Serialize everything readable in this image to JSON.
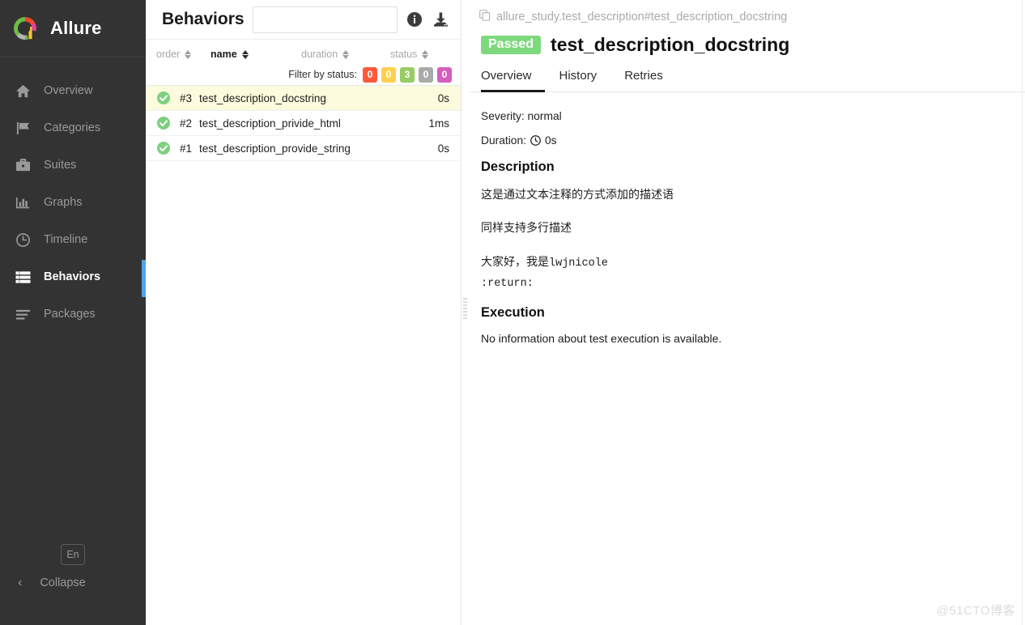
{
  "sidebar": {
    "brand": "Allure",
    "items": [
      {
        "label": "Overview",
        "icon": "home-icon",
        "active": false
      },
      {
        "label": "Categories",
        "icon": "flag-icon",
        "active": false
      },
      {
        "label": "Suites",
        "icon": "briefcase-icon",
        "active": false
      },
      {
        "label": "Graphs",
        "icon": "bar-chart-icon",
        "active": false
      },
      {
        "label": "Timeline",
        "icon": "clock-icon",
        "active": false
      },
      {
        "label": "Behaviors",
        "icon": "list-icon",
        "active": true
      },
      {
        "label": "Packages",
        "icon": "layers-icon",
        "active": false
      }
    ],
    "language_button": "En",
    "collapse_label": "Collapse",
    "active_indicator_color": "#4da3f0"
  },
  "list_pane": {
    "title": "Behaviors",
    "search": {
      "value": "",
      "placeholder": ""
    },
    "info_icon": "info-icon",
    "download_icon": "download-icon",
    "columns": [
      {
        "key": "order",
        "label": "order",
        "active": false
      },
      {
        "key": "name",
        "label": "name",
        "active": true
      },
      {
        "key": "duration",
        "label": "duration",
        "active": false
      },
      {
        "key": "status",
        "label": "status",
        "active": false
      }
    ],
    "filter": {
      "label": "Filter by status:",
      "badges": [
        {
          "status": "failed",
          "count": "0",
          "color": "#fd5a3e"
        },
        {
          "status": "broken",
          "count": "0",
          "color": "#ffd050"
        },
        {
          "status": "passed",
          "count": "3",
          "color": "#97cc64"
        },
        {
          "status": "skipped",
          "count": "0",
          "color": "#aaaaaa"
        },
        {
          "status": "unknown",
          "count": "0",
          "color": "#d35ebe"
        }
      ]
    },
    "rows": [
      {
        "order": "#3",
        "name": "test_description_docstring",
        "duration": "0s",
        "status": "passed",
        "selected": true
      },
      {
        "order": "#2",
        "name": "test_description_privide_html",
        "duration": "1ms",
        "status": "passed",
        "selected": false
      },
      {
        "order": "#1",
        "name": "test_description_provide_string",
        "duration": "0s",
        "status": "passed",
        "selected": false
      }
    ]
  },
  "detail": {
    "breadcrumb": "allure_study.test_description#test_description_docstring",
    "copy_icon": "copy-icon",
    "status_badge": "Passed",
    "status_badge_color": "#7ed97e",
    "title": "test_description_docstring",
    "tabs": [
      {
        "label": "Overview",
        "active": true
      },
      {
        "label": "History",
        "active": false
      },
      {
        "label": "Retries",
        "active": false
      }
    ],
    "severity_line": "Severity: normal",
    "duration_label": "Duration:",
    "duration_value": "0s",
    "duration_icon": "clock-icon",
    "description_heading": "Description",
    "description_paragraphs": [
      {
        "text": "这是通过文本注释的方式添加的描述语",
        "mono": false
      },
      {
        "text": "同样支持多行描述",
        "mono": false
      }
    ],
    "description_greeting_prefix": "大家好，我是",
    "description_greeting_mono": "lwjnicole",
    "description_return_token": ":return:",
    "execution_heading": "Execution",
    "execution_text": "No information about test execution is available."
  },
  "watermark": "@51CTO博客"
}
